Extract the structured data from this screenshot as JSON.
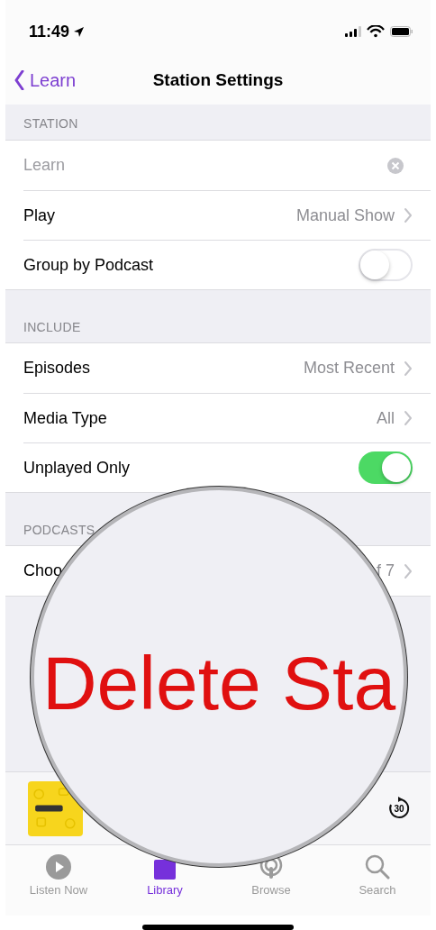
{
  "status_bar": {
    "time": "11:49"
  },
  "nav": {
    "back": "Learn",
    "title": "Station Settings"
  },
  "sections": [
    {
      "header": "STATION",
      "rows": [
        {
          "kind": "field",
          "placeholder": "Learn"
        },
        {
          "kind": "link",
          "label": "Play",
          "value": "Manual Show"
        },
        {
          "kind": "toggle",
          "label": "Group by Podcast",
          "on": false
        }
      ]
    },
    {
      "header": "INCLUDE",
      "rows": [
        {
          "kind": "link",
          "label": "Episodes",
          "value": "Most Recent"
        },
        {
          "kind": "link",
          "label": "Media Type",
          "value": "All"
        },
        {
          "kind": "toggle",
          "label": "Unplayed Only",
          "on": true
        }
      ]
    },
    {
      "header": "PODCASTS",
      "rows": [
        {
          "kind": "link",
          "label": "Choo",
          "value": "f 7"
        }
      ]
    }
  ],
  "mini_player": {
    "skip_label": "30"
  },
  "tab_bar": [
    {
      "label": "Listen Now",
      "selected": false,
      "kind": "play"
    },
    {
      "label": "Library",
      "selected": true,
      "kind": "library"
    },
    {
      "label": "Browse",
      "selected": false,
      "kind": "podcast"
    },
    {
      "label": "Search",
      "selected": false,
      "kind": "search"
    }
  ],
  "magnifier": {
    "text": "Delete Sta"
  }
}
